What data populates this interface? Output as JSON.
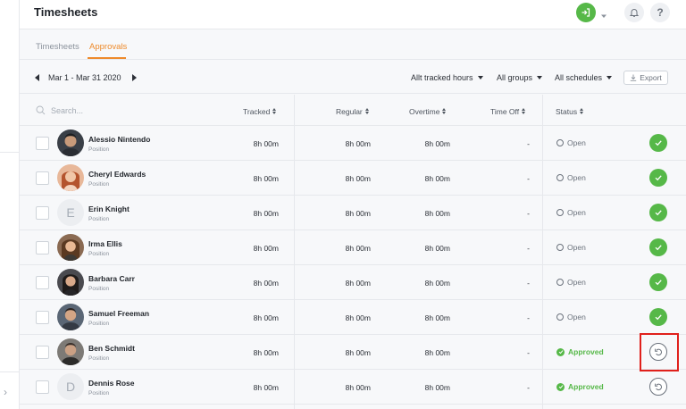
{
  "app": {
    "title": "Timesheets"
  },
  "tabs": [
    {
      "label": "Timesheets",
      "active": false
    },
    {
      "label": "Approvals",
      "active": true
    }
  ],
  "filters": {
    "date_range": "Mar 1  - Mar 31 2020",
    "tracked_hours": "Allt tracked hours",
    "groups": "All groups",
    "schedules": "All schedules",
    "export_label": "Export"
  },
  "table": {
    "search_placeholder": "Search...",
    "columns": {
      "tracked": "Tracked",
      "regular": "Regular",
      "overtime": "Overtime",
      "time_off": "Time Off",
      "status": "Status"
    },
    "rows": [
      {
        "name": "Alessio Nintendo",
        "position": "Position",
        "tracked": "8h 00m",
        "regular": "8h 00m",
        "overtime": "8h 00m",
        "time_off": "-",
        "status": "Open"
      },
      {
        "name": "Cheryl Edwards",
        "position": "Position",
        "tracked": "8h 00m",
        "regular": "8h 00m",
        "overtime": "8h 00m",
        "time_off": "-",
        "status": "Open"
      },
      {
        "name": "Erin Knight",
        "position": "Position",
        "initial": "E",
        "tracked": "8h 00m",
        "regular": "8h 00m",
        "overtime": "8h 00m",
        "time_off": "-",
        "status": "Open"
      },
      {
        "name": "Irma Ellis",
        "position": "Position",
        "tracked": "8h 00m",
        "regular": "8h 00m",
        "overtime": "8h 00m",
        "time_off": "-",
        "status": "Open"
      },
      {
        "name": "Barbara Carr",
        "position": "Position",
        "tracked": "8h 00m",
        "regular": "8h 00m",
        "overtime": "8h 00m",
        "time_off": "-",
        "status": "Open"
      },
      {
        "name": "Samuel Freeman",
        "position": "Position",
        "tracked": "8h 00m",
        "regular": "8h 00m",
        "overtime": "8h 00m",
        "time_off": "-",
        "status": "Open"
      },
      {
        "name": "Ben Schmidt",
        "position": "Position",
        "tracked": "8h 00m",
        "regular": "8h 00m",
        "overtime": "8h 00m",
        "time_off": "-",
        "status": "Approved"
      },
      {
        "name": "Dennis Rose",
        "position": "Position",
        "initial": "D",
        "tracked": "8h 00m",
        "regular": "8h 00m",
        "overtime": "8h 00m",
        "time_off": "-",
        "status": "Approved"
      }
    ]
  },
  "colors": {
    "accent": "#ee8a2b",
    "success": "#56b848",
    "highlight": "#e0201b"
  }
}
